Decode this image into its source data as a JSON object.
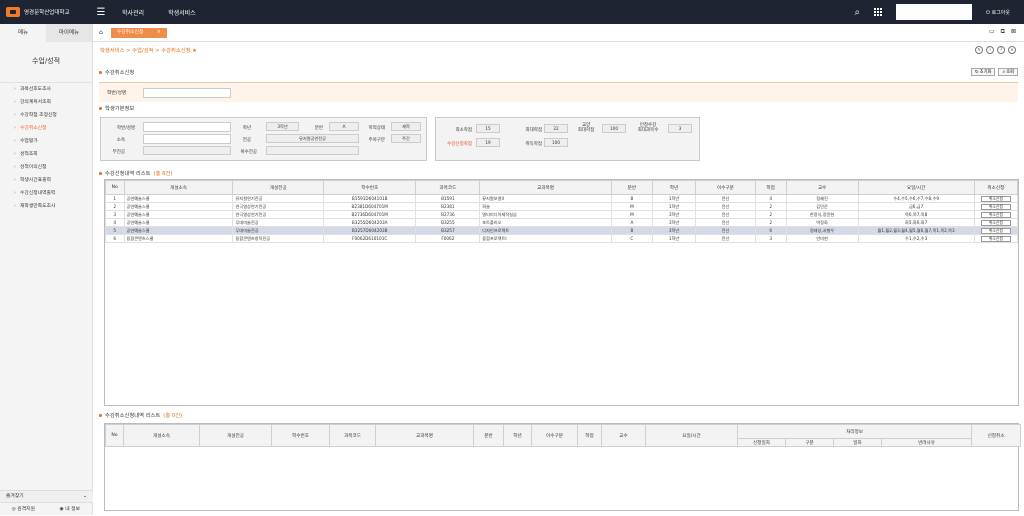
{
  "topbar": {
    "logo_text": "영경문학산업대학교",
    "menus": [
      "학사관리",
      "학생서비스"
    ],
    "logout": "로그아웃"
  },
  "sidebar": {
    "tabs": [
      "메뉴",
      "마이메뉴"
    ],
    "title": "수업/성적",
    "items": [
      "과목선호도조사",
      "강의계획서조회",
      "수강학점 조정신청",
      "수강취소신청",
      "수업평가",
      "성적조회",
      "성적이의신청",
      "학생시간표출력",
      "수강신청내역출력",
      "재학생만족도조사"
    ],
    "active_index": 3,
    "fav": "즐겨찾기",
    "bottom_buttons": [
      "원격지원",
      "내 정보"
    ]
  },
  "tabbar": {
    "tab_label": "수강취소신청",
    "close": "×"
  },
  "breadcrumb": "학생서비스 > 수업/성적 > 수강취소신청 ★",
  "search": {
    "section_title": "수강취소신청",
    "reset_button": "초기화",
    "search_button": "조회",
    "id_label": "학번/성명"
  },
  "student": {
    "section_title": "학생기본정보",
    "labels": {
      "id": "학번/성명",
      "year": "학년",
      "class": "분반",
      "status": "학적상태",
      "dept": "소속",
      "major": "전공",
      "day": "주야구분",
      "minor": "부전공",
      "double": "복수전공"
    },
    "values": {
      "year": "3학년",
      "class": "A",
      "status": "재학",
      "major": "뮤지컬공연전공",
      "day": "주간"
    },
    "credits": {
      "min_label": "최소학점",
      "min_value": "15",
      "max_label": "최대학점",
      "max_value": "22",
      "gen_label": "교양\n최대학점",
      "gen_value": "100",
      "retake_label": "인정수강\n최대과목수",
      "retake_value": "3",
      "applied_label": "수강신청학점",
      "applied_value": "19",
      "earned_label": "취득학점",
      "earned_value": "100"
    }
  },
  "list": {
    "section_title": "수강신청내역 리스트",
    "count": "(총 6건)",
    "columns": [
      "No",
      "개설소속",
      "개설전공",
      "학수번호",
      "과목코드",
      "교과목명",
      "분반",
      "학년",
      "이수구분",
      "학점",
      "교수",
      "요일/시간",
      "취소신청"
    ],
    "rows": [
      [
        "1",
        "공연예술스쿨",
        "뮤지컬연기전공",
        "B1591D604101B",
        "B1591",
        "뮤지컬보컬II",
        "B",
        "1학년",
        "전선",
        "4",
        "정혜진",
        "수4,수5,수6,수7,수8,수9",
        "취소신청"
      ],
      [
        "2",
        "공연예술스쿨",
        "연극영상연기전공",
        "B2381D604701M",
        "B2381",
        "화술",
        "M",
        "1학년",
        "전선",
        "2",
        "김민준",
        "금6,금7",
        "취소신청"
      ],
      [
        "3",
        "공연예술스쿨",
        "연극영상연기전공",
        "B2736D604701M",
        "B2736",
        "멀티미디어제작실습",
        "M",
        "3학년",
        "전선",
        "2",
        "한정식,정윤현",
        "목6,목7,목8",
        "취소신청"
      ],
      [
        "4",
        "공연예술스쿨",
        "무대미술전공",
        "B3255D604203A",
        "B3255",
        "포트폴리오",
        "A",
        "3학년",
        "전선",
        "2",
        "박정화",
        "화5,화6,화7",
        "취소신청"
      ],
      [
        "5",
        "공연예술스쿨",
        "무대미술전공",
        "B3257D604203B",
        "B3257",
        "디자인프로젝트",
        "B",
        "3학년",
        "전선",
        "6",
        "정태성,서형우",
        "월1,월2,월3,월4,월5,월6,월7,목1,목2,목3",
        "취소신청"
      ],
      [
        "6",
        "융합콘텐츠스쿨",
        "융합콘텐츠창작전공",
        "F0062D610101C",
        "F0062",
        "융합프로젝트I",
        "C",
        "1학년",
        "전선",
        "3",
        "안미현",
        "수1,수2,수3",
        "취소신청"
      ]
    ],
    "selected_row": 4
  },
  "cancel_list": {
    "section_title": "수강취소신청내역 리스트",
    "count": "(총 0건)",
    "columns": [
      "No",
      "개설소속",
      "개설전공",
      "학수번호",
      "과목코드",
      "교과목명",
      "분반",
      "학년",
      "이수구분",
      "학점",
      "교수",
      "요일/시간"
    ],
    "group_header": "처리정보",
    "sub_columns": [
      "신청일자",
      "구분",
      "일자",
      "반려사유"
    ],
    "last_column": "신청취소"
  }
}
